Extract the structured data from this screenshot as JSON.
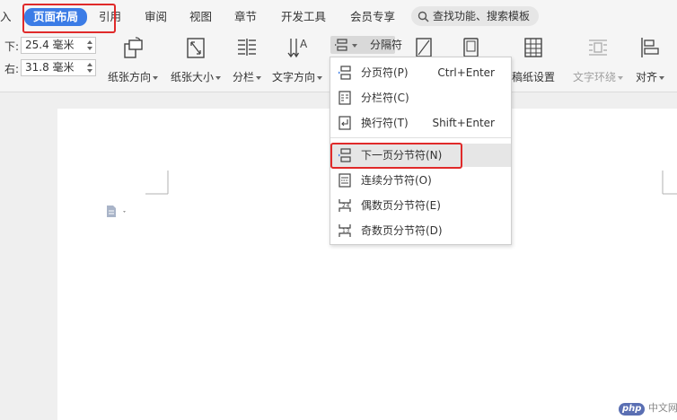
{
  "tabs": [
    {
      "label": "入"
    },
    {
      "label": "页面布局",
      "active": true
    },
    {
      "label": "引用"
    },
    {
      "label": "审阅"
    },
    {
      "label": "视图"
    },
    {
      "label": "章节"
    },
    {
      "label": "开发工具"
    },
    {
      "label": "会员专享"
    }
  ],
  "search": {
    "label": "查找功能、搜索模板",
    "icon": "search-icon"
  },
  "margins": {
    "bottom_label": "下:",
    "bottom_value": "25.4 毫米",
    "right_label": "右:",
    "right_value": "31.8 毫米"
  },
  "toolbar": {
    "orientation": "纸张方向",
    "size": "纸张大小",
    "columns": "分栏",
    "text_direction": "文字方向",
    "breaks": "分隔符",
    "manuscript": "稿纸设置",
    "text_wrap": "文字环绕",
    "align": "对齐"
  },
  "breaks_menu": {
    "items": [
      {
        "label": "分页符(P)",
        "shortcut": "Ctrl+Enter",
        "icon": "page-break-icon"
      },
      {
        "label": "分栏符(C)",
        "shortcut": "",
        "icon": "column-break-icon"
      },
      {
        "label": "换行符(T)",
        "shortcut": "Shift+Enter",
        "icon": "line-break-icon"
      },
      {
        "label": "下一页分节符(N)",
        "shortcut": "",
        "icon": "next-page-section-icon",
        "highlighted": true
      },
      {
        "label": "连续分节符(O)",
        "shortcut": "",
        "icon": "continuous-section-icon"
      },
      {
        "label": "偶数页分节符(E)",
        "shortcut": "",
        "icon": "even-page-section-icon"
      },
      {
        "label": "奇数页分节符(D)",
        "shortcut": "",
        "icon": "odd-page-section-icon"
      }
    ]
  },
  "watermark": {
    "brand": "php",
    "text": "中文网"
  },
  "colors": {
    "accent": "#3b7ce6",
    "highlight_box": "#e02a2a"
  }
}
